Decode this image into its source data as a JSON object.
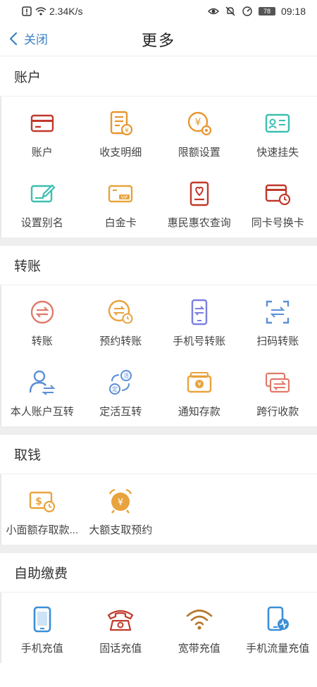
{
  "status": {
    "speed": "2.34K/s",
    "battery": "78",
    "time": "09:18"
  },
  "nav": {
    "back_label": "关闭",
    "title": "更多"
  },
  "sections": {
    "account": {
      "title": "账户",
      "items": [
        {
          "label": "账户",
          "icon": "card-icon",
          "color": "#c0392b"
        },
        {
          "label": "收支明细",
          "icon": "bill-details-icon",
          "color": "#e8962e"
        },
        {
          "label": "限额设置",
          "icon": "limit-settings-icon",
          "color": "#e8962e"
        },
        {
          "label": "快速挂失",
          "icon": "report-loss-icon",
          "color": "#3bbfb0"
        },
        {
          "label": "设置别名",
          "icon": "edit-alias-icon",
          "color": "#3bbfb0"
        },
        {
          "label": "白金卡",
          "icon": "vip-card-icon",
          "color": "#e8a33d"
        },
        {
          "label": "惠民惠农查询",
          "icon": "benefit-query-icon",
          "color": "#c0392b"
        },
        {
          "label": "同卡号换卡",
          "icon": "card-replace-icon",
          "color": "#c0392b"
        }
      ]
    },
    "transfer": {
      "title": "转账",
      "items": [
        {
          "label": "转账",
          "icon": "transfer-icon",
          "color": "#e07a6a"
        },
        {
          "label": "预约转账",
          "icon": "scheduled-transfer-icon",
          "color": "#e8a33d"
        },
        {
          "label": "手机号转账",
          "icon": "phone-transfer-icon",
          "color": "#7b7fe0"
        },
        {
          "label": "扫码转账",
          "icon": "scan-transfer-icon",
          "color": "#5b8fd6"
        },
        {
          "label": "本人账户互转",
          "icon": "own-account-transfer-icon",
          "color": "#5b8fd6"
        },
        {
          "label": "定活互转",
          "icon": "fixed-current-transfer-icon",
          "color": "#5b8fd6"
        },
        {
          "label": "通知存款",
          "icon": "notice-deposit-icon",
          "color": "#e8a33d"
        },
        {
          "label": "跨行收款",
          "icon": "interbank-collect-icon",
          "color": "#e07a6a"
        }
      ]
    },
    "withdraw": {
      "title": "取钱",
      "items": [
        {
          "label": "小面额存取款...",
          "icon": "small-cash-icon",
          "color": "#e8a33d"
        },
        {
          "label": "大额支取预约",
          "icon": "large-withdraw-alarm-icon",
          "color": "#e8a33d"
        }
      ]
    },
    "payment": {
      "title": "自助缴费",
      "items": [
        {
          "label": "手机充值",
          "icon": "mobile-recharge-icon",
          "color": "#3b8fd6"
        },
        {
          "label": "固话充值",
          "icon": "landline-icon",
          "color": "#c0392b"
        },
        {
          "label": "宽带充值",
          "icon": "wifi-icon",
          "color": "#b8752a"
        },
        {
          "label": "手机流量充值",
          "icon": "mobile-data-icon",
          "color": "#3b8fd6"
        }
      ]
    }
  }
}
